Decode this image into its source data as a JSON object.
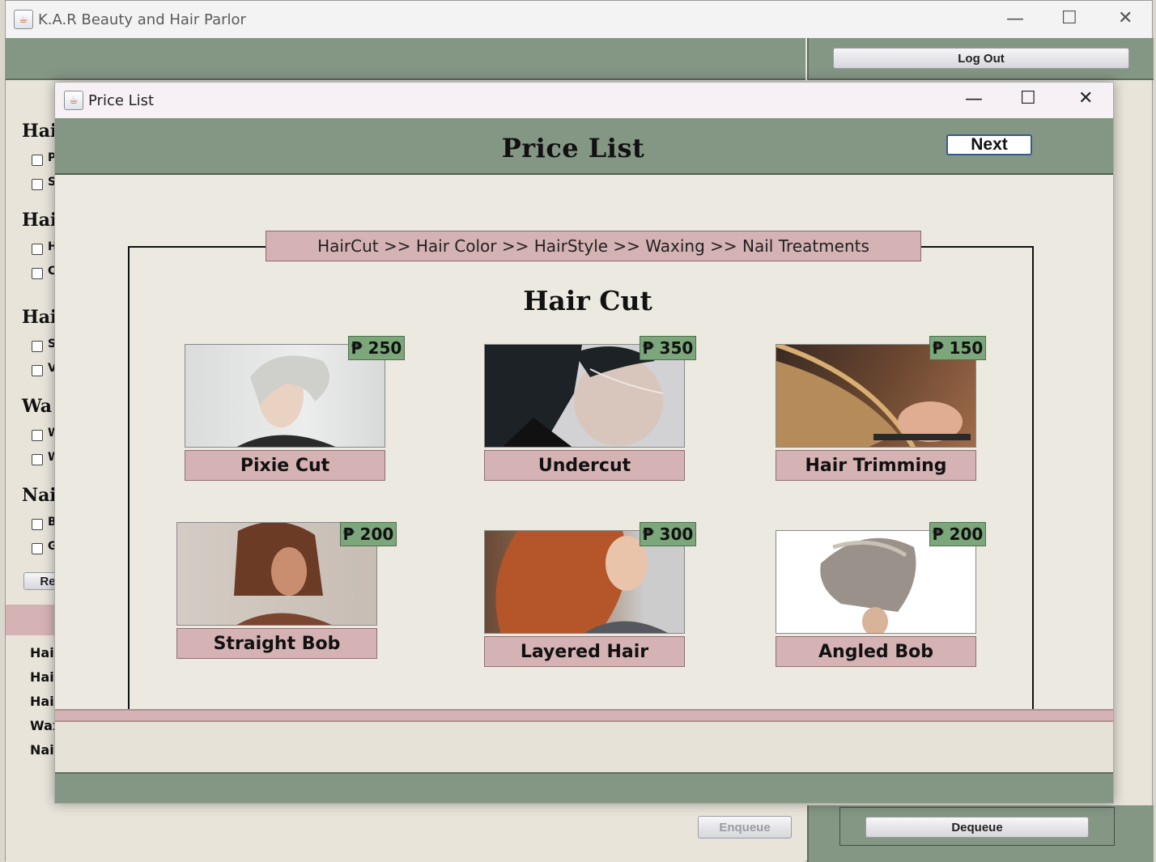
{
  "main_window": {
    "title": "K.A.R Beauty and Hair Parlor",
    "logout_label": "Log Out",
    "enqueue_label": "Enqueue",
    "dequeue_label": "Dequeue",
    "reset_label_partial": "Re",
    "side_headings_partial": [
      "Hair",
      "Hair",
      "Hair",
      "Wa",
      "Nail"
    ],
    "side_items_partial": [
      "P",
      "S",
      "H",
      "C",
      "S",
      "V",
      "W",
      "W",
      "B",
      "G"
    ],
    "left_list_partial": [
      "Hair",
      "Hair",
      "Hair",
      "Wax",
      "Nail"
    ]
  },
  "dialog": {
    "window_title": "Price List",
    "title": "Price List",
    "next_label": "Next",
    "breadcrumb": "HairCut >> Hair Color >> HairStyle >> Waxing >> Nail Treatments",
    "section_title": "Hair Cut",
    "cards": [
      {
        "name": "Pixie Cut",
        "price": "₱ 250"
      },
      {
        "name": "Undercut",
        "price": "₱ 350"
      },
      {
        "name": "Hair Trimming",
        "price": "₱ 150"
      },
      {
        "name": "Straight Bob",
        "price": "₱ 200"
      },
      {
        "name": "Layered Hair",
        "price": "₱ 300"
      },
      {
        "name": "Angled Bob",
        "price": "₱ 200"
      }
    ]
  },
  "window_controls": {
    "minimize": "—",
    "maximize": "☐",
    "close": "✕"
  },
  "colors": {
    "sage": "#849684",
    "rose": "#d5b2b3",
    "price_green": "#7ba77b",
    "cream": "#ece9e0"
  }
}
